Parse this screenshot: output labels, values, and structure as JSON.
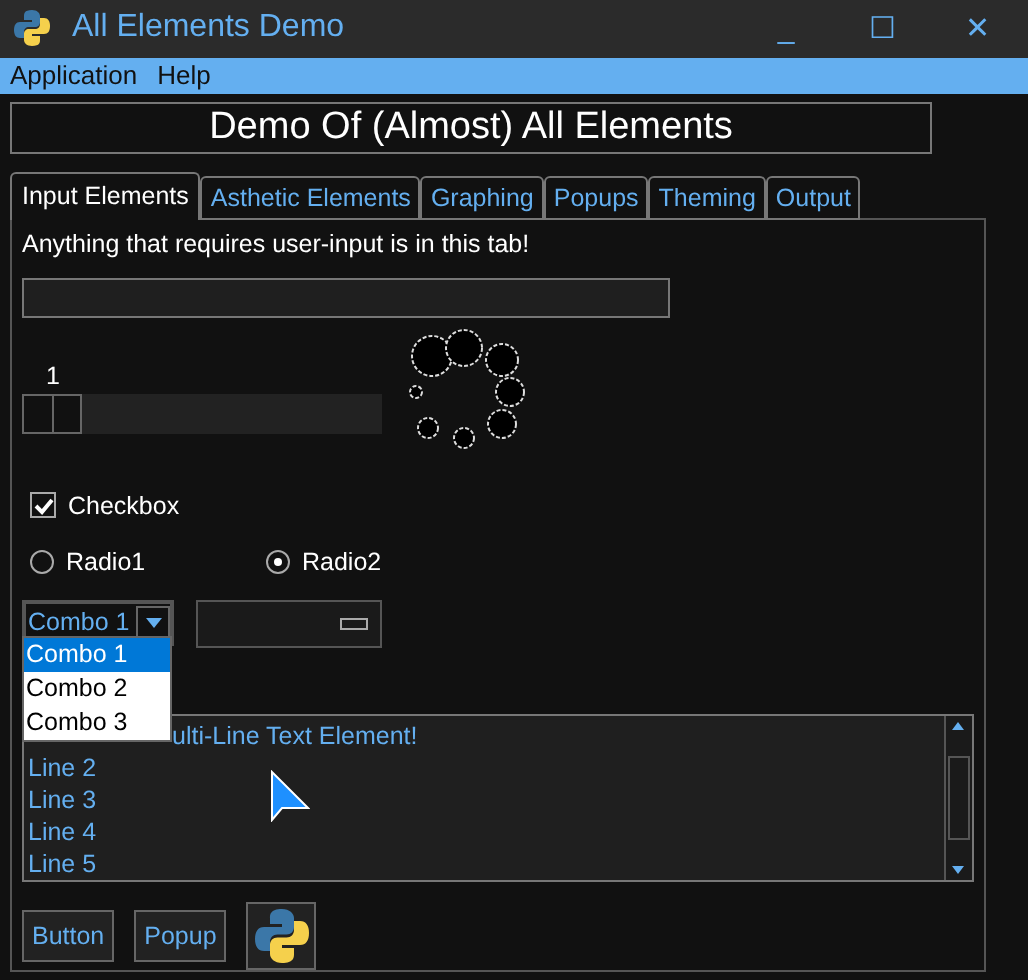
{
  "window": {
    "title": "All Elements Demo",
    "controls": [
      "_",
      "☐",
      "✕"
    ]
  },
  "menu": [
    "Application",
    "Help"
  ],
  "header": "Demo Of (Almost) All Elements",
  "tabs": [
    {
      "label": "Input Elements",
      "selected": true
    },
    {
      "label": "Asthetic Elements",
      "selected": false
    },
    {
      "label": "Graphing",
      "selected": false
    },
    {
      "label": "Popups",
      "selected": false
    },
    {
      "label": "Theming",
      "selected": false
    },
    {
      "label": "Output",
      "selected": false
    }
  ],
  "intro": "Anything that requires user-input is in this tab!",
  "slider": {
    "value": "1",
    "level": 0
  },
  "checkbox": {
    "label": "Checkbox",
    "checked": true
  },
  "radios": [
    {
      "label": "Radio1",
      "selected": false
    },
    {
      "label": "Radio2",
      "selected": true
    }
  ],
  "combo": {
    "value": "Combo 1",
    "options": [
      {
        "label": "Combo 1",
        "selected": true
      },
      {
        "label": "Combo 2",
        "selected": false
      },
      {
        "label": "Combo 3",
        "selected": false
      }
    ]
  },
  "multiline": {
    "lines": [
      "ulti-Line Text Element!",
      "Line 2",
      "Line 3",
      "Line 4",
      "Line 5"
    ]
  },
  "buttons": [
    "Button",
    "Popup"
  ]
}
